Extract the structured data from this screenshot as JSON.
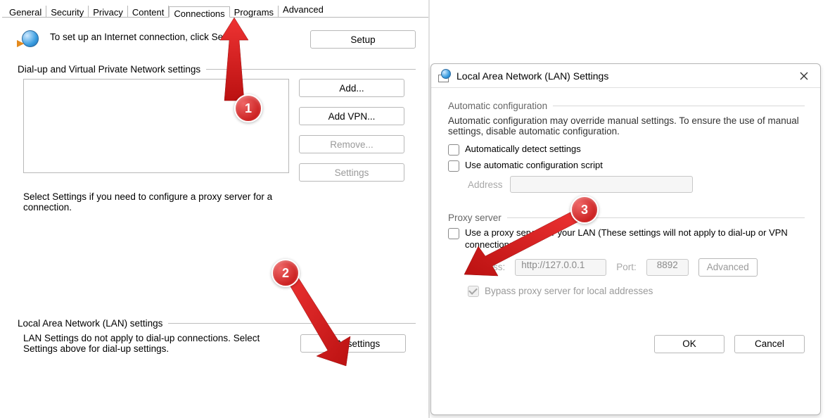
{
  "tabs": [
    "General",
    "Security",
    "Privacy",
    "Content",
    "Connections",
    "Programs",
    "Advanced"
  ],
  "active_tab_index": 4,
  "intro_text": "To set up an Internet connection, click Setup.",
  "setup_label": "Setup",
  "dialup_caption": "Dial-up and Virtual Private Network settings",
  "add_label": "Add...",
  "add_vpn_label": "Add VPN...",
  "remove_label": "Remove...",
  "settings_label": "Settings",
  "proxy_hint": "Select Settings if you need to configure a proxy server for a connection.",
  "lan_caption": "Local Area Network (LAN) settings",
  "lan_hint": "LAN Settings do not apply to dial-up connections. Select Settings above for dial-up settings.",
  "lan_button": "LAN settings",
  "dlg": {
    "title": "Local Area Network (LAN) Settings",
    "auto_caption": "Automatic configuration",
    "auto_text": "Automatic configuration may override manual settings.  To ensure the use of manual settings, disable automatic configuration.",
    "auto_detect": "Automatically detect settings",
    "use_script": "Use automatic configuration script",
    "addr_label": "Address",
    "proxy_caption": "Proxy server",
    "use_proxy": "Use a proxy server for your LAN (These settings will not apply to dial-up or VPN connections).",
    "address_label": "Address:",
    "address_value": "http://127.0.0.1",
    "port_label": "Port:",
    "port_value": "8892",
    "advanced_label": "Advanced",
    "bypass_label": "Bypass proxy server for local addresses",
    "ok_label": "OK",
    "cancel_label": "Cancel"
  },
  "badges": {
    "one": "1",
    "two": "2",
    "three": "3"
  }
}
